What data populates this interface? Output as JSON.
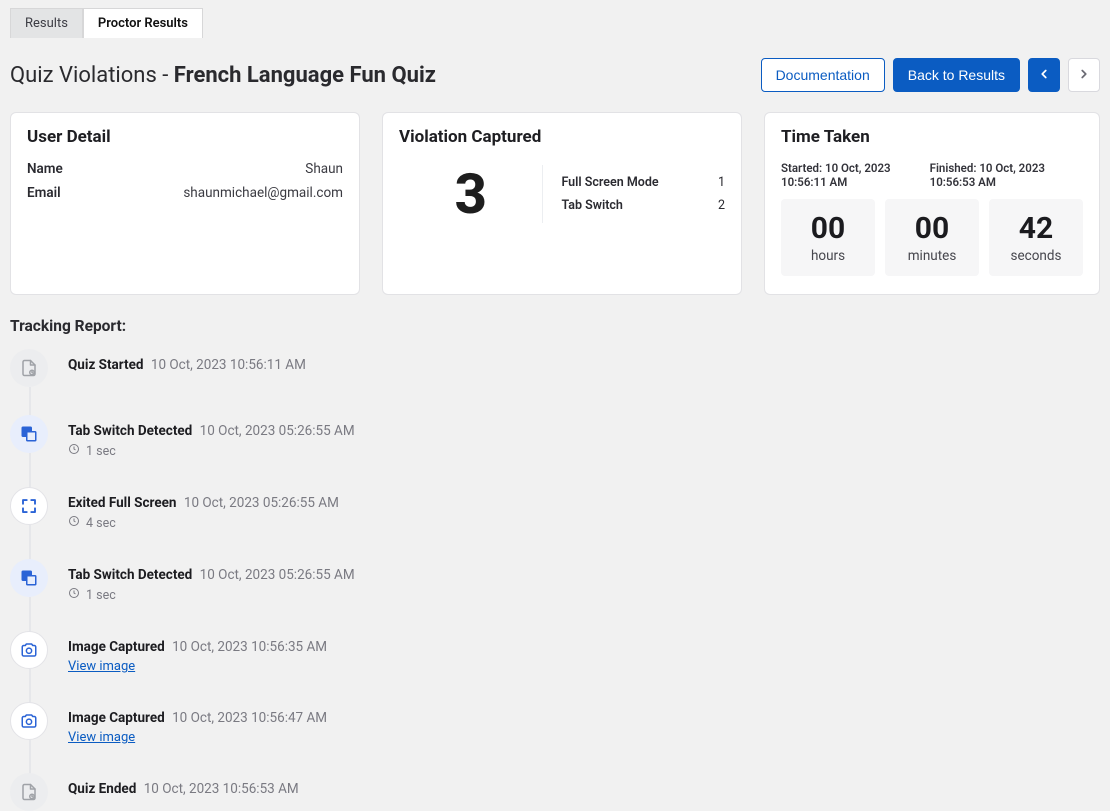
{
  "tabs": {
    "results": "Results",
    "proctor": "Proctor Results"
  },
  "header": {
    "title_prefix": "Quiz Violations - ",
    "title_bold": "French Language Fun Quiz",
    "doc_btn": "Documentation",
    "back_btn": "Back to Results"
  },
  "user": {
    "heading": "User Detail",
    "name_label": "Name",
    "name_value": "Shaun",
    "email_label": "Email",
    "email_value": "shaunmichael@gmail.com"
  },
  "violation": {
    "heading": "Violation Captured",
    "total": "3",
    "fs_label": "Full Screen Mode",
    "fs_value": "1",
    "ts_label": "Tab Switch",
    "ts_value": "2"
  },
  "time": {
    "heading": "Time Taken",
    "started": "Started: 10 Oct, 2023 10:56:11 AM",
    "finished": "Finished: 10 Oct, 2023 10:56:53 AM",
    "h_num": "00",
    "h_unit": "hours",
    "m_num": "00",
    "m_unit": "minutes",
    "s_num": "42",
    "s_unit": "seconds"
  },
  "tracking": {
    "heading": "Tracking Report:",
    "items": [
      {
        "label": "Quiz Started",
        "time": "10 Oct, 2023 10:56:11 AM"
      },
      {
        "label": "Tab Switch Detected",
        "time": "10 Oct, 2023 05:26:55 AM",
        "duration": "1 sec"
      },
      {
        "label": "Exited Full Screen",
        "time": "10 Oct, 2023 05:26:55 AM",
        "duration": "4 sec"
      },
      {
        "label": "Tab Switch Detected",
        "time": "10 Oct, 2023 05:26:55 AM",
        "duration": "1 sec"
      },
      {
        "label": "Image Captured",
        "time": "10 Oct, 2023 10:56:35 AM",
        "link": "View image"
      },
      {
        "label": "Image Captured",
        "time": "10 Oct, 2023 10:56:47 AM",
        "link": "View image"
      },
      {
        "label": "Quiz Ended",
        "time": "10 Oct, 2023 10:56:53 AM"
      }
    ]
  }
}
